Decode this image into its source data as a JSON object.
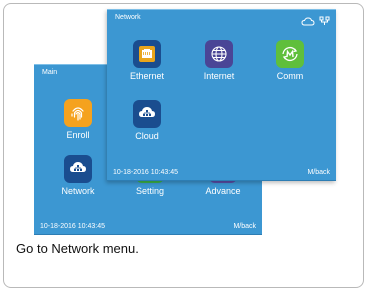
{
  "main_screen": {
    "title": "Main",
    "apps": [
      {
        "label": "Enroll",
        "icon": "fingerprint-icon",
        "color": "#f5a21e"
      },
      {
        "label": "Network",
        "icon": "cloud-network-icon",
        "color": "#1a4d8f"
      },
      {
        "label": "Setting",
        "icon": "gear-icon",
        "color": "#3bb54a"
      },
      {
        "label": "Advance",
        "icon": "advance-icon",
        "color": "#5a4ea8"
      }
    ],
    "datetime": "10-18-2016 10:43:45",
    "back": "M/back"
  },
  "network_screen": {
    "title": "Network",
    "apps": [
      {
        "label": "Ethernet",
        "icon": "ethernet-icon",
        "color": "#1a4d8f"
      },
      {
        "label": "Internet",
        "icon": "globe-icon",
        "color": "#4a4596"
      },
      {
        "label": "Comm",
        "icon": "comm-icon",
        "color": "#5fbf3c"
      },
      {
        "label": "Cloud",
        "icon": "cloud-network-icon",
        "color": "#1a4d8f"
      }
    ],
    "status_icons": [
      "cloud-status-icon",
      "network-status-icon"
    ],
    "datetime": "10-18-2016 10:43:45",
    "back": "M/back"
  },
  "caption": "Go to Network menu."
}
